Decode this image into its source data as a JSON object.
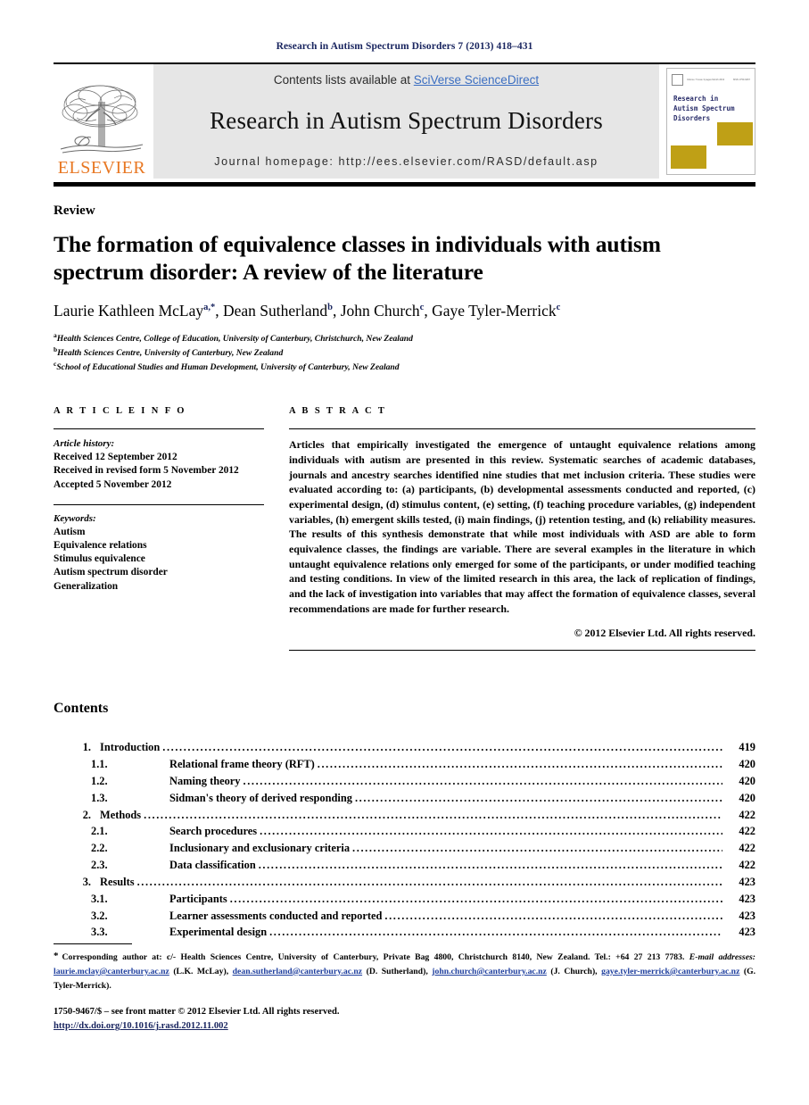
{
  "running_head": "Research in Autism Spectrum Disorders 7 (2013) 418–431",
  "masthead": {
    "publisher_name": "ELSEVIER",
    "contents_prefix": "Contents lists available at ",
    "sciencedirect_link": "SciVerse ScienceDirect",
    "journal_title": "Research in Autism Spectrum Disorders",
    "homepage_line": "Journal homepage: http://ees.elsevier.com/RASD/default.asp",
    "cover": {
      "title_line1": "Research in",
      "title_line2": "Autism Spectrum",
      "title_line3": "Disorders",
      "micro_left": "Volume 7 Issue 3 pages Month 2013",
      "micro_right": "ISSN 1750-9467",
      "accent_color": "#bfa016"
    },
    "accent_color": "#e87722"
  },
  "article": {
    "kind": "Review",
    "title": "The formation of equivalence classes in individuals with autism spectrum disorder: A review of the literature",
    "authors": [
      {
        "name": "Laurie Kathleen McLay",
        "marks": "a,*"
      },
      {
        "name": "Dean Sutherland",
        "marks": "b"
      },
      {
        "name": "John Church",
        "marks": "c"
      },
      {
        "name": "Gaye Tyler-Merrick",
        "marks": "c"
      }
    ],
    "affiliations": [
      {
        "mark": "a",
        "text": "Health Sciences Centre, College of Education, University of Canterbury, Christchurch, New Zealand"
      },
      {
        "mark": "b",
        "text": "Health Sciences Centre, University of Canterbury, New Zealand"
      },
      {
        "mark": "c",
        "text": "School of Educational Studies and Human Development, University of Canterbury, New Zealand"
      }
    ]
  },
  "article_info": {
    "heading": "A R T I C L E  I N F O",
    "history_label": "Article history:",
    "history": [
      "Received 12 September 2012",
      "Received in revised form 5 November 2012",
      "Accepted 5 November 2012"
    ],
    "keywords_label": "Keywords:",
    "keywords": [
      "Autism",
      "Equivalence relations",
      "Stimulus equivalence",
      "Autism spectrum disorder",
      "Generalization"
    ]
  },
  "abstract": {
    "heading": "A B S T R A C T",
    "body": "Articles that empirically investigated the emergence of untaught equivalence relations among individuals with autism are presented in this review. Systematic searches of academic databases, journals and ancestry searches identified nine studies that met inclusion criteria. These studies were evaluated according to: (a) participants, (b) developmental assessments conducted and reported, (c) experimental design, (d) stimulus content, (e) setting, (f) teaching procedure variables, (g) independent variables, (h) emergent skills tested, (i) main findings, (j) retention testing, and (k) reliability measures. The results of this synthesis demonstrate that while most individuals with ASD are able to form equivalence classes, the findings are variable. There are several examples in the literature in which untaught equivalence relations only emerged for some of the participants, or under modified teaching and testing conditions. In view of the limited research in this area, the lack of replication of findings, and the lack of investigation into variables that may affect the formation of equivalence classes, several recommendations are made for further research.",
    "copyright": "© 2012 Elsevier Ltd. All rights reserved."
  },
  "contents": {
    "heading": "Contents",
    "entries": [
      {
        "level": 1,
        "num": "1.",
        "label": "Introduction",
        "page": "419"
      },
      {
        "level": 2,
        "num": "1.1.",
        "label": "Relational frame theory (RFT)",
        "page": "420"
      },
      {
        "level": 2,
        "num": "1.2.",
        "label": "Naming theory",
        "page": "420"
      },
      {
        "level": 2,
        "num": "1.3.",
        "label": "Sidman's theory of derived responding",
        "page": "420"
      },
      {
        "level": 1,
        "num": "2.",
        "label": "Methods",
        "page": "422"
      },
      {
        "level": 2,
        "num": "2.1.",
        "label": "Search procedures",
        "page": "422"
      },
      {
        "level": 2,
        "num": "2.2.",
        "label": "Inclusionary and exclusionary criteria",
        "page": "422"
      },
      {
        "level": 2,
        "num": "2.3.",
        "label": "Data classification",
        "page": "422"
      },
      {
        "level": 1,
        "num": "3.",
        "label": "Results",
        "page": "423"
      },
      {
        "level": 2,
        "num": "3.1.",
        "label": "Participants",
        "page": "423"
      },
      {
        "level": 2,
        "num": "3.2.",
        "label": "Learner assessments conducted and reported",
        "page": "423"
      },
      {
        "level": 2,
        "num": "3.3.",
        "label": "Experimental design",
        "page": "423"
      }
    ]
  },
  "footnote": {
    "corresponding": "Corresponding author at: c/- Health Sciences Centre, University of Canterbury, Private Bag 4800, Christchurch 8140, New Zealand. Tel.: +64 27 213 7783.",
    "email_label": "E-mail addresses:",
    "emails": [
      {
        "address": "laurie.mclay@canterbury.ac.nz",
        "owner": "(L.K. McLay)"
      },
      {
        "address": "dean.sutherland@canterbury.ac.nz",
        "owner": "(D. Sutherland)"
      },
      {
        "address": "john.church@canterbury.ac.nz",
        "owner": "(J. Church)"
      },
      {
        "address": "gaye.tyler-merrick@canterbury.ac.nz",
        "owner": "(G. Tyler-Merrick)"
      }
    ]
  },
  "imprint": {
    "line1": "1750-9467/$ – see front matter © 2012 Elsevier Ltd. All rights reserved.",
    "doi": "http://dx.doi.org/10.1016/j.rasd.2012.11.002"
  }
}
